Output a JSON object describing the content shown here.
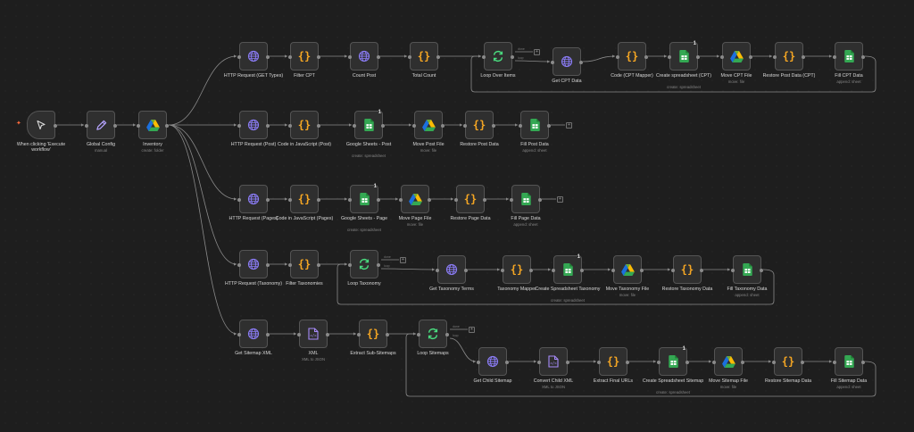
{
  "colors": {
    "canvas_bg": "#1e1e1e",
    "node_bg": "#2f2f2f",
    "node_border": "#545454",
    "edge": "#8a8a8a",
    "http_icon": "#8b7cf6",
    "code_icon": "#f5a623",
    "sheets_icon": "#34a853",
    "loop_icon": "#4ade80",
    "trigger_accent": "#ff6b3d"
  },
  "nodes": [
    {
      "id": "trigger",
      "label": "When clicking 'Execute workflow'",
      "subtitle": "",
      "icon": "cursor-icon"
    },
    {
      "id": "global-config",
      "label": "Global Config",
      "subtitle": "manual",
      "icon": "pencil-icon"
    },
    {
      "id": "inventory",
      "label": "Inventory",
      "subtitle": "create: folder",
      "icon": "drive-icon"
    },
    {
      "id": "http-get-types",
      "label": "HTTP Request (GET Types)",
      "subtitle": "",
      "icon": "globe-icon"
    },
    {
      "id": "filter-cpt",
      "label": "Filter CPT",
      "subtitle": "",
      "icon": "code-braces-icon"
    },
    {
      "id": "count-post",
      "label": "Count Post",
      "subtitle": "",
      "icon": "globe-icon"
    },
    {
      "id": "total-count",
      "label": "Total Count",
      "subtitle": "",
      "icon": "code-braces-icon"
    },
    {
      "id": "loop-over-items",
      "label": "Loop Over Items",
      "subtitle": "",
      "icon": "loop-icon"
    },
    {
      "id": "get-cpt-data",
      "label": "Get CPT Data",
      "subtitle": "",
      "icon": "globe-icon"
    },
    {
      "id": "code-cpt-mapper",
      "label": "Code (CPT Mapper)",
      "subtitle": "",
      "icon": "code-braces-icon"
    },
    {
      "id": "create-sheet-cpt",
      "label": "Create spreadsheet (CPT)",
      "subtitle": "create: spreadsheet",
      "icon": "sheets-icon",
      "badge": "1"
    },
    {
      "id": "move-cpt-file",
      "label": "Move CPT File",
      "subtitle": "move: file",
      "icon": "drive-icon"
    },
    {
      "id": "restore-post-data-cpt",
      "label": "Restore Post Data (CPT)",
      "subtitle": "",
      "icon": "code-braces-icon"
    },
    {
      "id": "fill-cpt-data",
      "label": "Fill CPT Data",
      "subtitle": "append: sheet",
      "icon": "sheets-icon"
    },
    {
      "id": "http-post",
      "label": "HTTP Request (Post)",
      "subtitle": "",
      "icon": "globe-icon"
    },
    {
      "id": "code-js-post",
      "label": "Code in JavaScript (Post)",
      "subtitle": "",
      "icon": "code-braces-icon"
    },
    {
      "id": "sheets-post",
      "label": "Google Sheets - Post",
      "subtitle": "create: spreadsheet",
      "icon": "sheets-icon",
      "badge": "1"
    },
    {
      "id": "move-post-file",
      "label": "Move Post File",
      "subtitle": "move: file",
      "icon": "drive-icon"
    },
    {
      "id": "restore-post-data",
      "label": "Restore Post Data",
      "subtitle": "",
      "icon": "code-braces-icon"
    },
    {
      "id": "fill-post-data",
      "label": "Fill Post Data",
      "subtitle": "append: sheet",
      "icon": "sheets-icon"
    },
    {
      "id": "http-pages",
      "label": "HTTP Request (Pages)",
      "subtitle": "",
      "icon": "globe-icon"
    },
    {
      "id": "code-js-pages",
      "label": "Code in JavaScript (Pages)",
      "subtitle": "",
      "icon": "code-braces-icon"
    },
    {
      "id": "sheets-page",
      "label": "Google Sheets - Page",
      "subtitle": "create: spreadsheet",
      "icon": "sheets-icon",
      "badge": "1"
    },
    {
      "id": "move-page-file",
      "label": "Move Page File",
      "subtitle": "move: file",
      "icon": "drive-icon"
    },
    {
      "id": "restore-page-data",
      "label": "Restore Page Data",
      "subtitle": "",
      "icon": "code-braces-icon"
    },
    {
      "id": "fill-page-data",
      "label": "Fill Page Data",
      "subtitle": "append: sheet",
      "icon": "sheets-icon"
    },
    {
      "id": "http-taxonomy",
      "label": "HTTP Request (Taxonomy)",
      "subtitle": "",
      "icon": "globe-icon"
    },
    {
      "id": "filter-taxonomies",
      "label": "Filter Taxonomies",
      "subtitle": "",
      "icon": "code-braces-icon"
    },
    {
      "id": "loop-taxonomy",
      "label": "Loop Taxonomy",
      "subtitle": "",
      "icon": "loop-icon"
    },
    {
      "id": "get-taxonomy-terms",
      "label": "Get Taxonomy Terms",
      "subtitle": "",
      "icon": "globe-icon"
    },
    {
      "id": "taxonomy-mapper",
      "label": "Taxonomy Mapper",
      "subtitle": "",
      "icon": "code-braces-icon"
    },
    {
      "id": "create-sheet-taxonomy",
      "label": "Create Spreadsheet Taxonomy",
      "subtitle": "create: spreadsheet",
      "icon": "sheets-icon",
      "badge": "1"
    },
    {
      "id": "move-taxonomy-file",
      "label": "Move Taxonomy File",
      "subtitle": "move: file",
      "icon": "drive-icon"
    },
    {
      "id": "restore-taxonomy-data",
      "label": "Restore Taxonomy Data",
      "subtitle": "",
      "icon": "code-braces-icon"
    },
    {
      "id": "fill-taxonomy-data",
      "label": "Fill Taxonomy Data",
      "subtitle": "append: sheet",
      "icon": "sheets-icon"
    },
    {
      "id": "get-sitemap-xml",
      "label": "Get Sitemap XML",
      "subtitle": "",
      "icon": "globe-icon"
    },
    {
      "id": "xml",
      "label": "XML",
      "subtitle": "XML to JSON",
      "icon": "xml-file-icon"
    },
    {
      "id": "extract-sub-sitemaps",
      "label": "Extract Sub-Sitemaps",
      "subtitle": "",
      "icon": "code-braces-icon"
    },
    {
      "id": "loop-sitemaps",
      "label": "Loop Sitemaps",
      "subtitle": "",
      "icon": "loop-icon"
    },
    {
      "id": "get-child-sitemap",
      "label": "Get Child Sitemap",
      "subtitle": "",
      "icon": "globe-icon"
    },
    {
      "id": "convert-child-xml",
      "label": "Convert Child XML",
      "subtitle": "XML to JSON",
      "icon": "xml-file-icon"
    },
    {
      "id": "extract-final-urls",
      "label": "Extract Final URLs",
      "subtitle": "",
      "icon": "code-braces-icon"
    },
    {
      "id": "create-sheet-sitemap",
      "label": "Create Spreadsheet Sitemap",
      "subtitle": "create: spreadsheet",
      "icon": "sheets-icon",
      "badge": "1"
    },
    {
      "id": "move-sitemap-file",
      "label": "Move Sitemap File",
      "subtitle": "move: file",
      "icon": "drive-icon"
    },
    {
      "id": "restore-sitemap-data",
      "label": "Restore Sitemap Data",
      "subtitle": "",
      "icon": "code-braces-icon"
    },
    {
      "id": "fill-sitemap-data",
      "label": "Fill Sitemap Data",
      "subtitle": "append: sheet",
      "icon": "sheets-icon"
    }
  ],
  "loop_output_labels": {
    "done": "done",
    "loop": "loop"
  },
  "add_node_symbol": "+"
}
